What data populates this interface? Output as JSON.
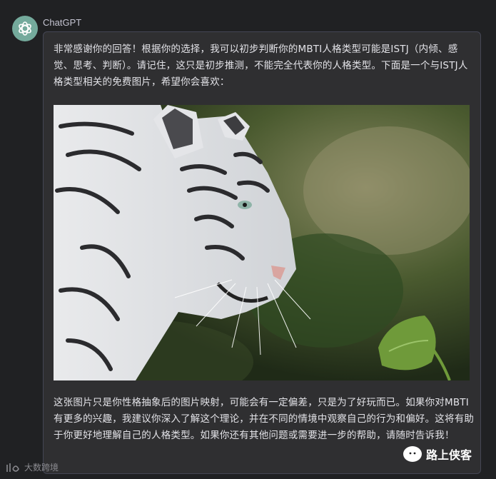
{
  "sender": {
    "name": "ChatGPT"
  },
  "message": {
    "intro": "非常感谢你的回答！根据你的选择，我可以初步判断你的MBTI人格类型可能是ISTJ（内倾、感觉、思考、判断）。请记住，这只是初步推测，不能完全代表你的人格类型。下面是一个与ISTJ人格类型相关的免费图片，希望你会喜欢：",
    "outro": "这张图片只是你性格抽象后的图片映射，可能会有一定偏差，只是为了好玩而已。如果你对MBTI有更多的兴趣，我建议你深入了解这个理论，并在不同的情境中观察自己的行为和偏好。这将有助于你更好地理解自己的人格类型。如果你还有其他问题或需要进一步的帮助，请随时告诉我！"
  },
  "image": {
    "subject": "white tiger walking near a green leaf"
  },
  "watermarks": {
    "left": "大数跨境",
    "right": "路上侠客"
  },
  "colors": {
    "background": "#202123",
    "bubble": "#2f2f31",
    "avatar": "#74aa9c",
    "text": "#e3e3e8"
  },
  "icons": [
    "openai-logo-icon",
    "wechat-icon",
    "dashuo-logo-icon"
  ]
}
